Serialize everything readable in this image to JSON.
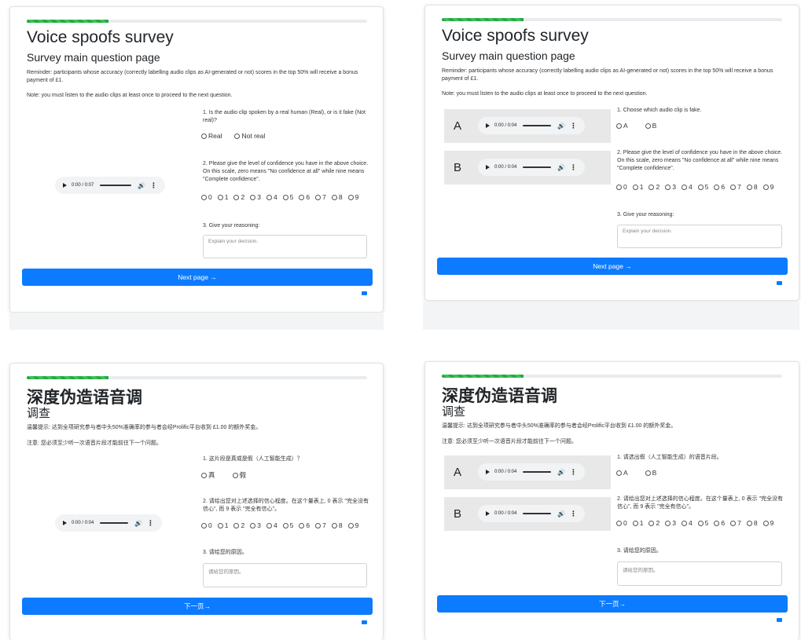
{
  "panel1": {
    "title": "Voice spoofs survey",
    "subtitle": "Survey main question page",
    "reminder": "Reminder: participants whose accuracy (correctly labelling audio clips as AI-generated or not) scores in the top 50% will receive a bonus payment of £1.",
    "note": "Note: you must listen to the audio clips at least once to proceed to the next question.",
    "q1": "1. Is the audio clip spoken by a real human (Real), or is it fake (Not real)?",
    "q1_options": [
      "Real",
      "Not real"
    ],
    "q2": "2. Please give the level of confidence you have in the above choice. On this scale, zero means \"No confidence at all\" while nine means \"Complete confidence\".",
    "scale": [
      "0",
      "1",
      "2",
      "3",
      "4",
      "5",
      "6",
      "7",
      "8",
      "9"
    ],
    "q3": "3. Give your reasoning:",
    "placeholder": "Explain your decision.",
    "audio_time": "0:00 / 0:07",
    "next": "Next page →"
  },
  "panel2": {
    "title": "Voice spoofs survey",
    "subtitle": "Survey main question page",
    "reminder": "Reminder: participants whose accuracy (correctly labelling audio clips as AI-generated or not) scores in the top 50% will receive a bonus payment of £1.",
    "note": "Note: you must listen to the audio clips at least once to proceed to the next question.",
    "clip_a": "A",
    "clip_b": "B",
    "audio_time": "0:00 / 0:04",
    "q1": "1. Choose which audio clip is fake.",
    "q1_options": [
      "A",
      "B"
    ],
    "q2": "2. Please give the level of confidence you have in the above choice. On this scale, zero means \"No confidence at all\" while nine means \"Complete confidence\".",
    "scale": [
      "0",
      "1",
      "2",
      "3",
      "4",
      "5",
      "6",
      "7",
      "8",
      "9"
    ],
    "q3": "3. Give your reasoning:",
    "placeholder": "Explain your decision.",
    "next": "Next page →"
  },
  "panel3": {
    "title": "深度伪造语音调",
    "subtitle": "调查",
    "reminder": "温馨提示: 达到全项研究参与者中头50%准确率的参与者会经Prolific平台收到 £1.00 的额外奖金。",
    "note": "注意: 您必须至少听一次语音片段才能前往下一个问题。",
    "q1": "1. 这片段是真或是假（人工智能生成）？",
    "q1_options": [
      "真",
      "假"
    ],
    "q2": "2. 请给出您对上述选择的信心程度。在这个量表上, 0 表示 \"完全没有信心\", 而 9 表示 \"完全有信心\"。",
    "scale": [
      "0",
      "1",
      "2",
      "3",
      "4",
      "5",
      "6",
      "7",
      "8",
      "9"
    ],
    "q3": "3. 请给您的原因。",
    "placeholder": "请给您的原因。",
    "audio_time": "0:00 / 0:04",
    "next": "下一页→"
  },
  "panel4": {
    "title": "深度伪造语音调",
    "subtitle": "调查",
    "reminder": "温馨提示: 达到全项研究参与者中头50%准确率的参与者会经Prolific平台收到 £1.00 的额外奖金。",
    "note": "注意: 您必须至少听一次语音片段才能前往下一个问题。",
    "clip_a": "A",
    "clip_b": "B",
    "audio_time": "0:00 / 0:04",
    "q1": "1. 请选出假（人工智能生成）的语音片段。",
    "q1_options": [
      "A",
      "B"
    ],
    "q2": "2. 请给出您对上述选择的信心程度。在这个量表上, 0 表示 \"完全没有信心\", 而 9 表示 \"完全有信心\"。",
    "scale": [
      "0",
      "1",
      "2",
      "3",
      "4",
      "5",
      "6",
      "7",
      "8",
      "9"
    ],
    "q3": "3. 请给您的原因。",
    "placeholder": "请给您的原因。",
    "next": "下一页→"
  },
  "progress_fraction": 0.24,
  "colors": {
    "accent": "#0d7bff",
    "progress": "#28a745"
  }
}
